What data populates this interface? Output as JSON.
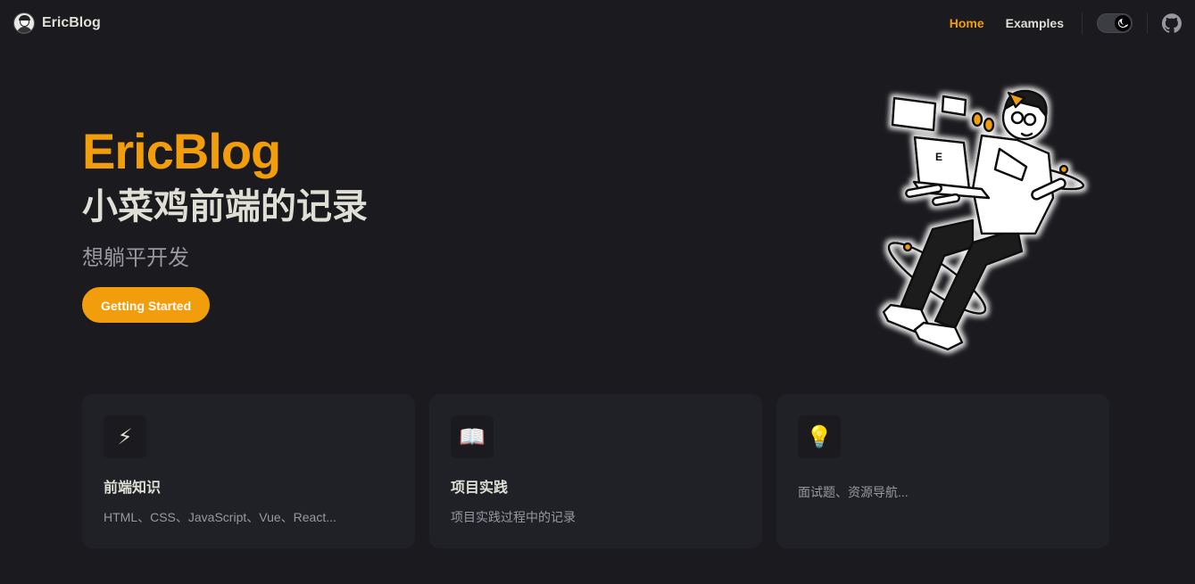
{
  "nav": {
    "brand": "EricBlog",
    "links": [
      {
        "label": "Home",
        "active": true
      },
      {
        "label": "Examples",
        "active": false
      }
    ],
    "icons": [
      "theme-toggle-moon-icon",
      "github-icon"
    ]
  },
  "hero": {
    "name": "EricBlog",
    "text": "小菜鸡前端的记录",
    "tagline": "想躺平开发",
    "action": "Getting Started"
  },
  "features": [
    {
      "icon": "⚡",
      "icon_name": "lightning-icon",
      "title": "前端知识",
      "details": "HTML、CSS、JavaScript、Vue、React..."
    },
    {
      "icon": "📖",
      "icon_name": "open-book-icon",
      "title": "项目实践",
      "details": "项目实践过程中的记录"
    },
    {
      "icon": "💡",
      "icon_name": "light-bulb-icon",
      "title": "",
      "details": "面试题、资源导航..."
    }
  ],
  "colors": {
    "brand": "#f29d0b",
    "background": "#1b1b1f",
    "card": "#202127",
    "text": "#dfdfd6",
    "muted": "#98989f"
  }
}
